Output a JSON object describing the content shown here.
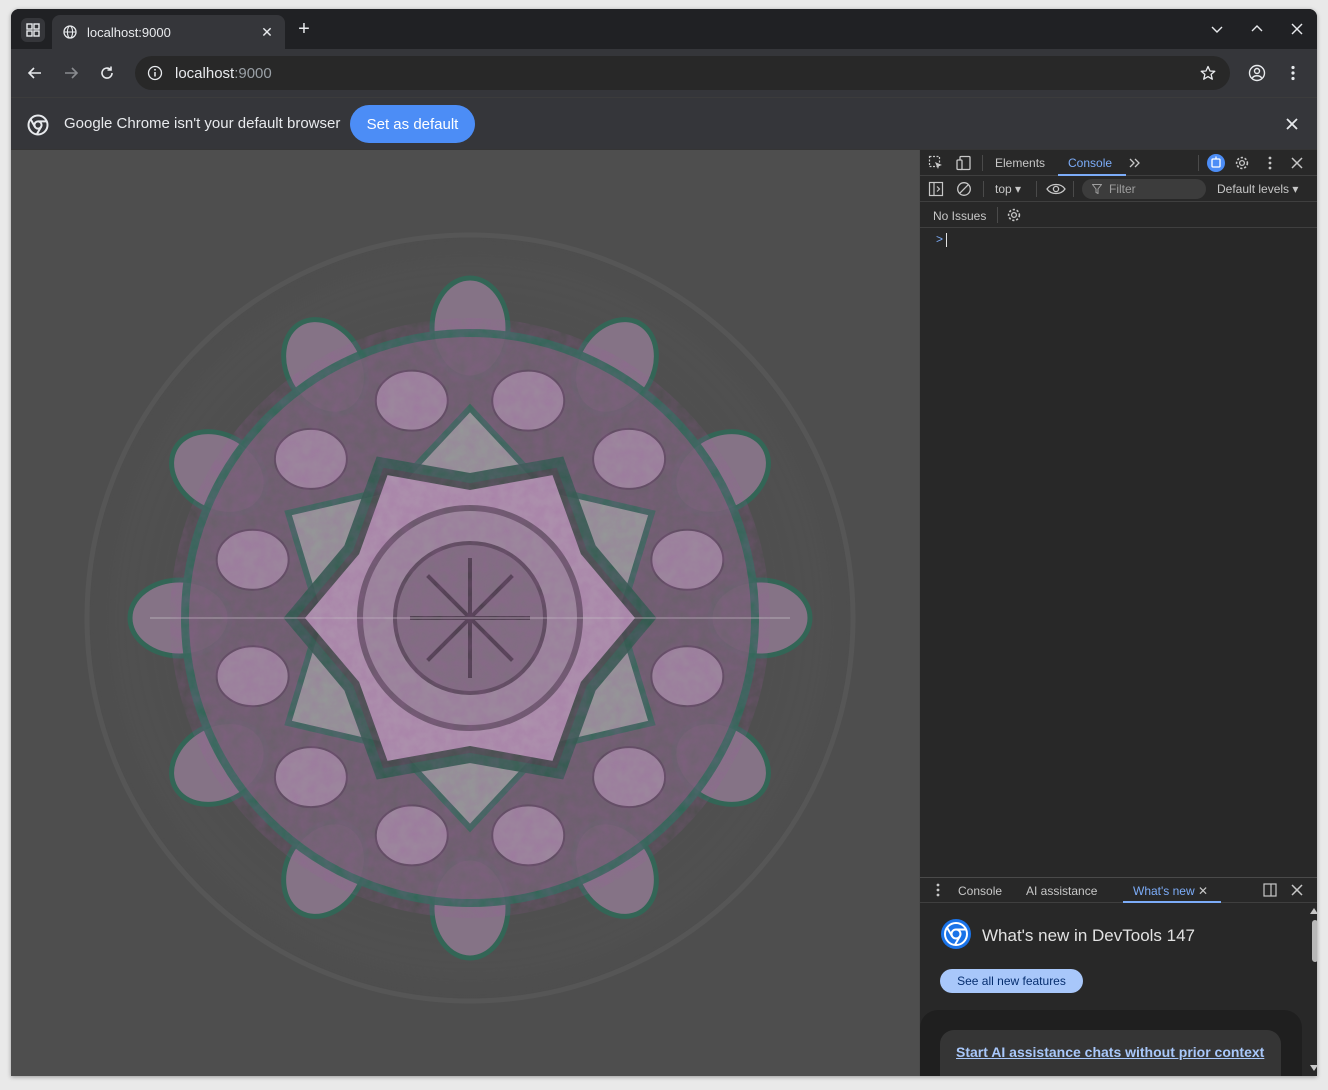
{
  "browser": {
    "tab": {
      "title": "localhost:9000"
    },
    "address": {
      "host": "localhost",
      "port": ":9000"
    }
  },
  "infobar": {
    "message": "Google Chrome isn't your default browser",
    "button": "Set as default"
  },
  "devtools": {
    "tabs": [
      "Elements",
      "Console"
    ],
    "active_tab": "Console",
    "context": "top",
    "filter_placeholder": "Filter",
    "levels": "Default levels",
    "issues": "No Issues",
    "prompt": ">",
    "drawer": {
      "tabs": [
        "Console",
        "AI assistance",
        "What's new"
      ],
      "active_tab": "What's new"
    },
    "whats_new": {
      "title": "What's new in DevTools 147",
      "button": "See all new features",
      "card_link": "Start AI assistance chats without prior context"
    }
  },
  "colors": {
    "accent": "#7cacf8",
    "infobar_button": "#4c8df6",
    "page_background": "#4e4e4e",
    "mandala_purple": "#b89ab8",
    "mandala_green": "#2f6a58"
  }
}
